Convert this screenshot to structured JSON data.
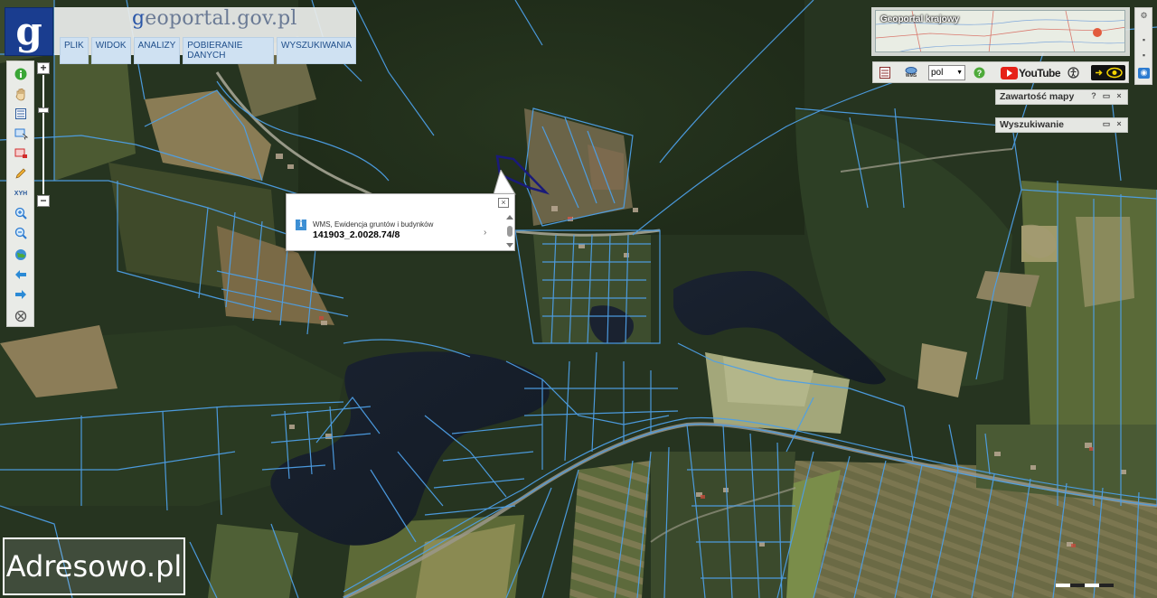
{
  "header": {
    "logo_letter": "g",
    "site_title_prefix": "g",
    "site_title_rest": "eoportal.gov.pl",
    "menu": [
      "PLIK",
      "WIDOK",
      "ANALIZY",
      "POBIERANIE DANYCH",
      "WYSZUKIWANIA"
    ]
  },
  "toolbar": {
    "icons": [
      "info-icon",
      "pan-hand-icon",
      "layers-list-icon",
      "select-area-icon",
      "clear-selection-icon",
      "pencil-icon",
      "xyh-coordinates-icon",
      "zoom-in-icon",
      "zoom-out-icon",
      "full-extent-globe-icon",
      "back-arrow-icon",
      "forward-arrow-icon",
      "cancel-icon"
    ],
    "xyh_label": "XYH",
    "zoom_plus": "+",
    "zoom_minus": "−"
  },
  "popup": {
    "source": "WMS, Ewidencja gruntów i budynków",
    "value": "141903_2.0028.74/8",
    "close": "×",
    "info": "i",
    "next": "›"
  },
  "top_right": {
    "overview_label": "Geoportal krajowy",
    "language": "pol",
    "youtube_text": "YouTube",
    "wms_label": "WMS"
  },
  "panels": {
    "contents": "Zawartość mapy",
    "search": "Wyszukiwanie",
    "help": "?",
    "restore": "▭",
    "close": "×"
  },
  "watermark": "Adresowo.pl",
  "colors": {
    "parcel_lines": "#4d9fe6",
    "selected_parcel": "#1a1a7a",
    "logo_bg": "#1a3d8f",
    "menu_text": "#1f4e8a"
  }
}
